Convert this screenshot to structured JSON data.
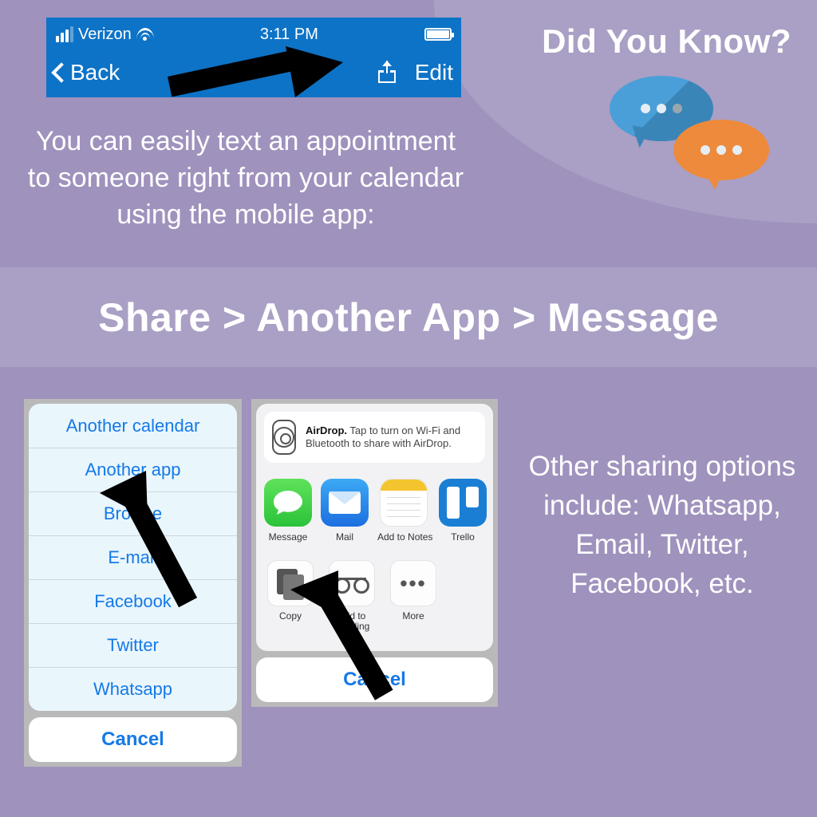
{
  "corner": {
    "title": "Did You Know?"
  },
  "statusbar": {
    "carrier": "Verizon",
    "time": "3:11 PM"
  },
  "navbar": {
    "back": "Back",
    "edit": "Edit"
  },
  "intro": "You can easily text an appointment to someone right from your calendar using the mobile app:",
  "breadcrumb": "Share > Another App > Message",
  "menuA": {
    "items": [
      "Another calendar",
      "Another app",
      "Browse",
      "E-mail",
      "Facebook",
      "Twitter",
      "Whatsapp"
    ],
    "cancel": "Cancel"
  },
  "sheet": {
    "airdrop_bold": "AirDrop.",
    "airdrop_text": " Tap to turn on Wi-Fi and Bluetooth to share with AirDrop.",
    "apps": [
      "Message",
      "Mail",
      "Add to Notes",
      "Trello"
    ],
    "actions": [
      "Copy",
      "Add to Reading List",
      "More"
    ],
    "cancel": "Cancel"
  },
  "sidecopy": "Other sharing options include: Whatsapp, Email, Twitter, Facebook, etc."
}
